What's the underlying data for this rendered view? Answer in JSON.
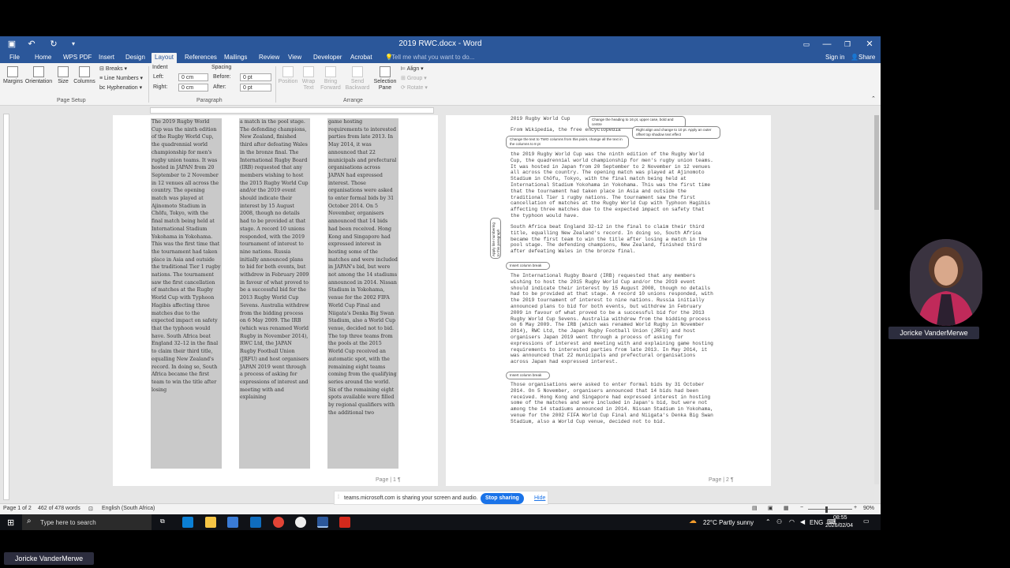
{
  "window": {
    "title": "2019 RWC.docx - Word"
  },
  "tabs": [
    "File",
    "Home",
    "WPS PDF",
    "Insert",
    "Design",
    "Layout",
    "References",
    "Mailings",
    "Review",
    "View",
    "Developer",
    "Acrobat"
  ],
  "active_tab": "Layout",
  "tell_me": "Tell me what you want to do...",
  "signin": "Sign in",
  "share": "Share",
  "ribbon": {
    "margins": "Margins",
    "orientation": "Orientation",
    "size": "Size",
    "columns": "Columns",
    "breaks": "Breaks",
    "line_numbers": "Line Numbers",
    "hyphenation": "Hyphenation",
    "page_setup": "Page Setup",
    "indent": "Indent",
    "left_label": "Left:",
    "left_value": "0 cm",
    "right_label": "Right:",
    "right_value": "0 cm",
    "spacing": "Spacing",
    "before_label": "Before:",
    "before_value": "0 pt",
    "after_label": "After:",
    "after_value": "0 pt",
    "paragraph": "Paragraph",
    "position": "Position",
    "wrap_text": "Wrap Text",
    "bring_forward": "Bring Forward",
    "send_backward": "Send Backward",
    "selection_pane": "Selection Pane",
    "align": "Align",
    "group": "Group",
    "rotate": "Rotate",
    "arrange": "Arrange"
  },
  "page1": {
    "col1": "The 2019 Rugby World Cup was the ninth edition of the Rugby World Cup, the quadrennial world championship for men's rugby union teams. It was hosted in JAPAN from 20 September to 2 November in 12 venues all across the country. The opening match was played at Ajinomoto Stadium in Chōfu, Tokyo, with the final match being held at International Stadium Yokohama in Yokohama. This was the first time that the tournament had taken place in Asia and outside the traditional Tier 1 rugby nations. The tournament saw the first cancellation of matches at the Rugby World Cup with Typhoon Hagibis affecting three matches due to the expected impact on safety that the typhoon would have. South Africa beat England 32–12 in the final to claim their third title, equalling New Zealand's record. In doing so, South Africa became the first team to win the title after losing",
    "col2": "a match in the pool stage. The defending champions, New Zealand, finished third after defeating Wales in the bronze final. The International Rugby Board (IRB) requested that any members wishing to host the 2015 Rugby World Cup and/or the 2019 event should indicate their interest by 15 August 2008, though no details had to be provided at that stage. A record 10 unions responded, with the 2019 tournament of interest to nine nations. Russia initially announced plans to bid for both events, but withdrew in February 2009 in favour of what proved to be a successful bid for the 2013 Rugby World Cup Sevens. Australia withdrew from the bidding process on 6 May 2009. The IRB (which was renamed World Rugby in November 2014), RWC Ltd, the JAPAN Rugby Football Union (JRFU) and host organisers JAPAN 2019 went through a process of asking for expressions of interest and meeting with and explaining",
    "col3": "game hosting requirements to interested parties from late 2013. In May 2014, it was announced that 22 municipals and prefectural organisations across JAPAN had expressed interest. Those organisations were asked to enter formal bids by 31 October 2014. On 5 November, organisers announced that 14 bids had been received. Hong Kong and Singapore had expressed interest in hosting some of the matches and were included in JAPAN's bid, but were not among the 14 stadiums announced in 2014. Nissan Stadium in Yokohama, venue for the 2002 FIFA World Cup Final and Niigata's Denka Big Swan Stadium, also a World Cup venue, decided not to bid. The top three teams from the pools at the 2015 World Cup received an automatic spot, with the remaining eight teams coming from the qualifying series around the world. Six of the remaining eight spots available were filled by regional qualifiers with the additional two",
    "page_number": "Page | 1 ¶"
  },
  "page2": {
    "heading1": "2019 Rugby World Cup",
    "heading2": "From Wikipedia, the free encyclopedia",
    "para1": "the 2019 Rugby World Cup was the ninth edition of the Rugby World Cup, the quadrennial world championship for men's rugby union teams. It was hosted in Japan from 20 September to 2 November in 12 venues all across the country. The opening match was played at Ajinomoto Stadium in Chōfu, Tokyo, with the final match being held at International Stadium Yokohama in Yokohama. This was the first time that the tournament had taken place in Asia and outside the traditional Tier 1 rugby nations. The tournament saw the first cancellation of matches at the Rugby World Cup with Typhoon Hagibis affecting three matches due to the expected impact on safety that the typhoon would have.",
    "para2": "South Africa beat England 32–12 in the final to claim their third title, equalling New Zealand's record. In doing so, South Africa became the first team to win the title after losing a match in the pool stage. The defending champions, New Zealand, finished third after defeating Wales in the bronze final.",
    "para3": "The International Rugby Board (IRB) requested that any members wishing to host the 2015 Rugby World Cup and/or the 2019 event should indicate their interest by 15 August 2008, though no details had to be provided at that stage. A record 10 unions responded, with the 2019 tournament of interest to nine nations. Russia initially announced plans to bid for both events, but withdrew in February 2009 in favour of what proved to be a successful bid for the 2013 Rugby World Cup Sevens. Australia withdrew from the bidding process on 6 May 2009. The IRB (which was renamed World Rugby in November 2014), RWC Ltd, the Japan Rugby Football Union (JRFU) and host organisers Japan 2019 went through a process of asking for expressions of interest and meeting with and explaining game hosting requirements to interested parties from late 2013. In May 2014, it was announced that 22 municipals and prefectural organisations across Japan had expressed interest.",
    "para4": "Those organisations were asked to enter formal bids by 31 October 2014. On 5 November, organisers announced that 14 bids had been received. Hong Kong and Singapore had expressed interest in hosting some of the matches and were included in Japan's bid, but were not among the 14 stadiums announced in 2014. Nissan Stadium in Yokohama, venue for the 2002 FIFA World Cup Final and Niigata's Denka Big Swan Stadium, also a World Cup venue, decided not to bid.",
    "page_number": "Page | 2 ¶",
    "comments": [
      "Change the heading to 16 pt, upper case, bold and centre",
      "Right align and change to 10 pt. Apply an outer offset top shadow text effect",
      "Change the text to TWO columns from this point, change all the text in the columns to 8 pt",
      "Apply line numbering to this paragraph",
      "Insert column break",
      "Insert column break"
    ]
  },
  "status": {
    "page": "Page 1 of 2",
    "words": "462 of 478 words",
    "language": "English (South Africa)",
    "zoom": "90%"
  },
  "sharebar": {
    "text": "teams.microsoft.com is sharing your screen and audio.",
    "stop": "Stop sharing",
    "hide": "Hide"
  },
  "taskbar": {
    "search": "Type here to search",
    "weather": "22°C  Partly sunny",
    "lang": "ENG",
    "time": "08:55",
    "date": "2026/02/04"
  },
  "participant": {
    "name": "Joricke VanderMerwe"
  },
  "self_name": "Joricke VanderMerwe",
  "colors": {
    "word_blue": "#2b579a",
    "highlight_pink": "#e0338a"
  }
}
